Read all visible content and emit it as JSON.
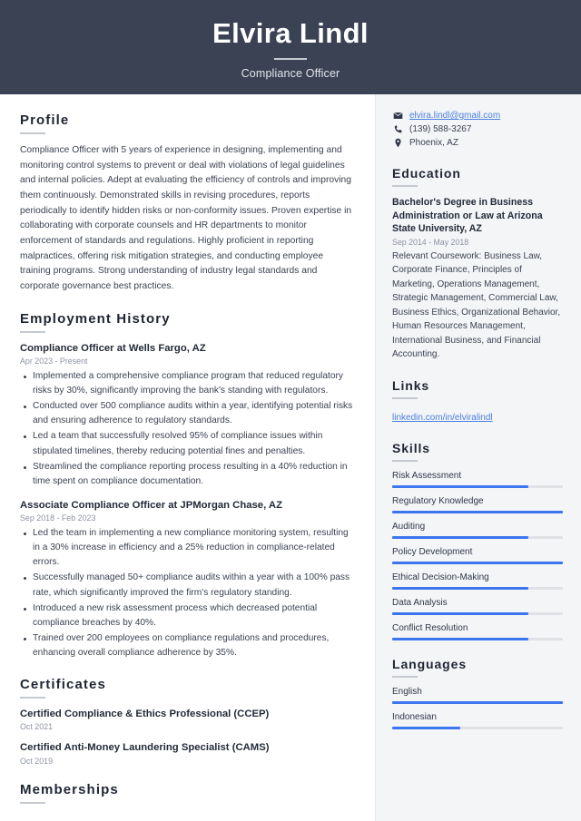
{
  "header": {
    "name": "Elvira Lindl",
    "job_title": "Compliance Officer"
  },
  "colors": {
    "header_bg": "#3a4254",
    "sidebar_bg": "#f4f5f7",
    "accent_blue": "#3b76f0",
    "link_blue": "#4a7fe0",
    "heading": "#1f2533",
    "body_text": "#3b4251",
    "muted": "#8d93a1"
  },
  "main": {
    "profile": {
      "heading": "Profile",
      "text": "Compliance Officer with 5 years of experience in designing, implementing and monitoring control systems to prevent or deal with violations of legal guidelines and internal policies. Adept at evaluating the efficiency of controls and improving them continuously. Demonstrated skills in revising procedures, reports periodically to identify hidden risks or non-conformity issues. Proven expertise in collaborating with corporate counsels and HR departments to monitor enforcement of standards and regulations. Highly proficient in reporting malpractices, offering risk mitigation strategies, and conducting employee training programs. Strong understanding of industry legal standards and corporate governance best practices."
    },
    "employment": {
      "heading": "Employment History",
      "entries": [
        {
          "title": "Compliance Officer at Wells Fargo, AZ",
          "date": "Apr 2023 - Present",
          "bullets": [
            "Implemented a comprehensive compliance program that reduced regulatory risks by 30%, significantly improving the bank's standing with regulators.",
            "Conducted over 500 compliance audits within a year, identifying potential risks and ensuring adherence to regulatory standards.",
            "Led a team that successfully resolved 95% of compliance issues within stipulated timelines, thereby reducing potential fines and penalties.",
            "Streamlined the compliance reporting process resulting in a 40% reduction in time spent on compliance documentation."
          ]
        },
        {
          "title": "Associate Compliance Officer at JPMorgan Chase, AZ",
          "date": "Sep 2018 - Feb 2023",
          "bullets": [
            "Led the team in implementing a new compliance monitoring system, resulting in a 30% increase in efficiency and a 25% reduction in compliance-related errors.",
            "Successfully managed 50+ compliance audits within a year with a 100% pass rate, which significantly improved the firm's regulatory standing.",
            "Introduced a new risk assessment process which decreased potential compliance breaches by 40%.",
            "Trained over 200 employees on compliance regulations and procedures, enhancing overall compliance adherence by 35%."
          ]
        }
      ]
    },
    "certificates": {
      "heading": "Certificates",
      "entries": [
        {
          "title": "Certified Compliance & Ethics Professional (CCEP)",
          "date": "Oct 2021"
        },
        {
          "title": "Certified Anti-Money Laundering Specialist (CAMS)",
          "date": "Oct 2019"
        }
      ]
    },
    "memberships": {
      "heading": "Memberships"
    }
  },
  "sidebar": {
    "contact": [
      {
        "icon": "envelope-icon",
        "glyph": "✉",
        "text": "elvira.lindl@gmail.com",
        "is_link": true
      },
      {
        "icon": "phone-icon",
        "glyph": "✆",
        "text": "(139) 588-3267",
        "is_link": false
      },
      {
        "icon": "map-pin-icon",
        "glyph": "⚉",
        "text": "Phoenix, AZ",
        "is_link": false
      }
    ],
    "education": {
      "heading": "Education",
      "entry": {
        "title": "Bachelor's Degree in Business Administration or Law at Arizona State University, AZ",
        "date": "Sep 2014 - May 2018",
        "description": "Relevant Coursework: Business Law, Corporate Finance, Principles of Marketing, Operations Management, Strategic Management, Commercial Law, Business Ethics, Organizational Behavior, Human Resources Management, International Business, and Financial Accounting."
      }
    },
    "links": {
      "heading": "Links",
      "items": [
        {
          "label": "linkedin.com/in/elviralindl"
        }
      ]
    },
    "skills": {
      "heading": "Skills",
      "items": [
        {
          "label": "Risk Assessment",
          "level": 80
        },
        {
          "label": "Regulatory Knowledge",
          "level": 100
        },
        {
          "label": "Auditing",
          "level": 80
        },
        {
          "label": "Policy Development",
          "level": 100
        },
        {
          "label": "Ethical Decision-Making",
          "level": 80
        },
        {
          "label": "Data Analysis",
          "level": 80
        },
        {
          "label": "Conflict Resolution",
          "level": 80
        }
      ]
    },
    "languages": {
      "heading": "Languages",
      "items": [
        {
          "label": "English",
          "level": 100
        },
        {
          "label": "Indonesian",
          "level": 40
        }
      ]
    }
  }
}
